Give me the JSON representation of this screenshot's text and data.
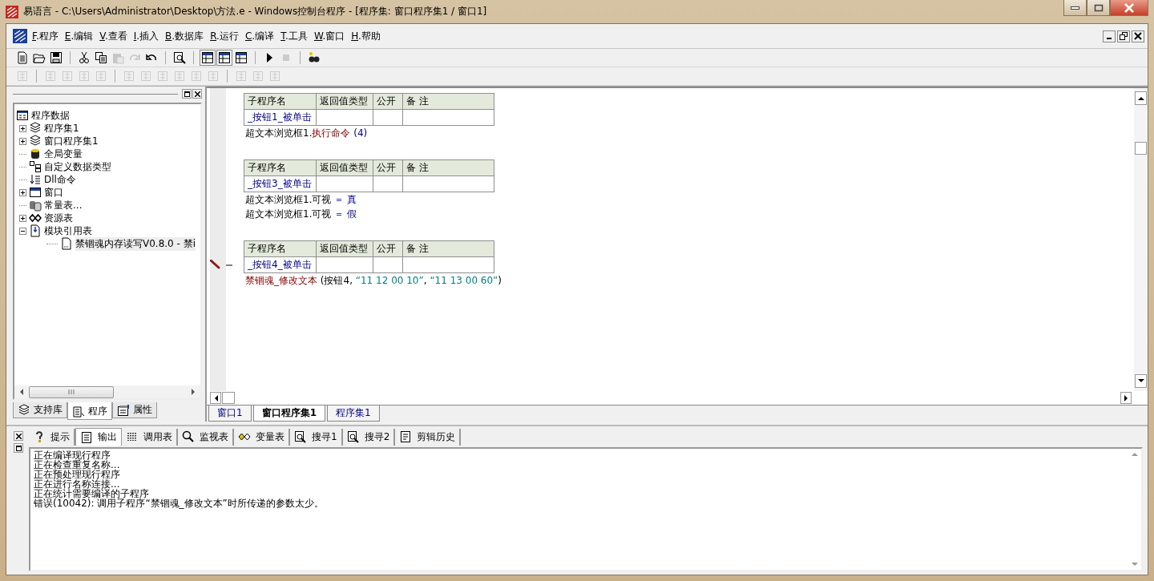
{
  "window": {
    "title": "易语言 - C:\\Users\\Administrator\\Desktop\\方法.e - Windows控制台程序 - [程序集: 窗口程序集1 / 窗口1]"
  },
  "menu": [
    {
      "label": "F.程序"
    },
    {
      "label": "E.编辑"
    },
    {
      "label": "V.查看"
    },
    {
      "label": "I.插入"
    },
    {
      "label": "B.数据库"
    },
    {
      "label": "R.运行"
    },
    {
      "label": "C.编译"
    },
    {
      "label": "T.工具"
    },
    {
      "label": "W.窗口"
    },
    {
      "label": "H.帮助"
    }
  ],
  "toolbar": [
    [
      {
        "kind": "new",
        "disabled": false,
        "pressed": false
      },
      {
        "kind": "open",
        "disabled": false,
        "pressed": false
      },
      {
        "kind": "save",
        "disabled": false,
        "pressed": false
      }
    ],
    [
      {
        "kind": "cut",
        "disabled": false,
        "pressed": false
      },
      {
        "kind": "copy",
        "disabled": false,
        "pressed": false
      },
      {
        "kind": "paste",
        "disabled": true,
        "pressed": false
      },
      {
        "kind": "redo",
        "disabled": true,
        "pressed": false
      },
      {
        "kind": "undo",
        "disabled": false,
        "pressed": false
      }
    ],
    [
      {
        "kind": "find",
        "disabled": false,
        "pressed": false
      }
    ],
    [
      {
        "kind": "layout",
        "disabled": false,
        "pressed": true
      },
      {
        "kind": "layout",
        "disabled": false,
        "pressed": true
      },
      {
        "kind": "layout",
        "disabled": false,
        "pressed": false
      }
    ],
    [
      {
        "kind": "run",
        "disabled": false,
        "pressed": false
      },
      {
        "kind": "stop",
        "disabled": true,
        "pressed": false
      }
    ],
    [
      {
        "kind": "binoculars",
        "disabled": false,
        "pressed": false
      }
    ]
  ],
  "align_toolbar": [
    [
      {
        "kind": "align",
        "disabled": true
      }
    ],
    [
      {
        "kind": "align",
        "disabled": true
      },
      {
        "kind": "align",
        "disabled": true
      },
      {
        "kind": "align",
        "disabled": true
      },
      {
        "kind": "align",
        "disabled": true
      }
    ],
    [
      {
        "kind": "align",
        "disabled": true
      },
      {
        "kind": "align",
        "disabled": true
      },
      {
        "kind": "align",
        "disabled": true
      },
      {
        "kind": "align",
        "disabled": true
      },
      {
        "kind": "align",
        "disabled": true
      },
      {
        "kind": "align",
        "disabled": true
      }
    ],
    [
      {
        "kind": "align",
        "disabled": true
      },
      {
        "kind": "align",
        "disabled": true
      },
      {
        "kind": "align",
        "disabled": true
      }
    ]
  ],
  "tree": [
    {
      "label": "程序数据",
      "kind": "root",
      "selected": false,
      "children": [
        {
          "label": "程序集1",
          "kind": "module",
          "expanded": false,
          "selected": false
        },
        {
          "label": "窗口程序集1",
          "kind": "module",
          "expanded": false,
          "selected": false
        },
        {
          "label": "全局变量",
          "kind": "global",
          "selected": false
        },
        {
          "label": "自定义数据类型",
          "kind": "type",
          "selected": false
        },
        {
          "label": "Dll命令",
          "kind": "dll",
          "selected": false
        },
        {
          "label": "窗口",
          "kind": "window",
          "expanded": false,
          "selected": false
        },
        {
          "label": "常量表...",
          "kind": "const",
          "selected": false
        },
        {
          "label": "资源表",
          "kind": "resource",
          "expanded": false,
          "selected": false
        },
        {
          "label": "模块引用表",
          "kind": "modules",
          "expanded": true,
          "selected": false,
          "children": [
            {
              "label": "禁锢魂内存读写V0.8.0 - 禁i",
              "kind": "file",
              "selected": true
            }
          ]
        }
      ]
    }
  ],
  "side_tabs": [
    {
      "label": "支持库",
      "kind": "lib",
      "selected": false
    },
    {
      "label": "程序",
      "kind": "program",
      "selected": true
    },
    {
      "label": "属性",
      "kind": "props",
      "selected": false
    }
  ],
  "subs": [
    {
      "columns": [
        "子程序名",
        "返回值类型",
        "公开",
        "备 注"
      ],
      "name": "_按钮1_被单击",
      "editing": false,
      "lines": [
        [
          {
            "kind": "object",
            "text": "超文本浏览框1."
          },
          {
            "kind": "command",
            "text": "执行命令"
          },
          {
            "kind": "arg",
            "text": " (4)"
          }
        ]
      ]
    },
    {
      "columns": [
        "子程序名",
        "返回值类型",
        "公开",
        "备 注"
      ],
      "name": "_按钮3_被单击",
      "editing": false,
      "lines": [
        [
          {
            "kind": "object",
            "text": "超文本浏览框1.可视"
          },
          {
            "kind": "arg",
            "text": " ＝ 真"
          }
        ],
        [
          {
            "kind": "object",
            "text": "超文本浏览框1.可视"
          },
          {
            "kind": "arg",
            "text": " ＝ 假"
          }
        ]
      ]
    },
    {
      "columns": [
        "子程序名",
        "返回值类型",
        "公开",
        "备 注"
      ],
      "name": "_按钮4_被单击",
      "editing": true,
      "lines": [
        [
          {
            "kind": "command",
            "text": "禁锢魂_修改文本"
          },
          {
            "kind": "object",
            "text": " (按钮4, "
          },
          {
            "kind": "string",
            "text": "“11 12 00 10”"
          },
          {
            "kind": "object",
            "text": ", "
          },
          {
            "kind": "string",
            "text": "“11 13 00 60”"
          },
          {
            "kind": "object",
            "text": ")"
          }
        ]
      ]
    }
  ],
  "doc_tabs": [
    {
      "label": "窗口1",
      "selected": false
    },
    {
      "label": "窗口程序集1",
      "selected": true
    },
    {
      "label": "程序集1",
      "selected": false
    }
  ],
  "output_tabs": [
    {
      "label": "提示",
      "kind": "hint",
      "selected": false
    },
    {
      "label": "输出",
      "kind": "output",
      "selected": true
    },
    {
      "label": "调用表",
      "kind": "calls",
      "selected": false
    },
    {
      "label": "监视表",
      "kind": "watch",
      "selected": false
    },
    {
      "label": "变量表",
      "kind": "vars",
      "selected": false
    },
    {
      "label": "搜寻1",
      "kind": "search",
      "selected": false
    },
    {
      "label": "搜寻2",
      "kind": "search",
      "selected": false
    },
    {
      "label": "剪辑历史",
      "kind": "clip",
      "selected": false
    }
  ],
  "output": [
    "正在编译现行程序",
    "正在检查重复名称...",
    "正在预处理现行程序",
    "正在进行名称连接...",
    "正在统计需要编译的子程序",
    "错误(10042): 调用子程序“禁锢魂_修改文本”时所传递的参数太少。"
  ]
}
